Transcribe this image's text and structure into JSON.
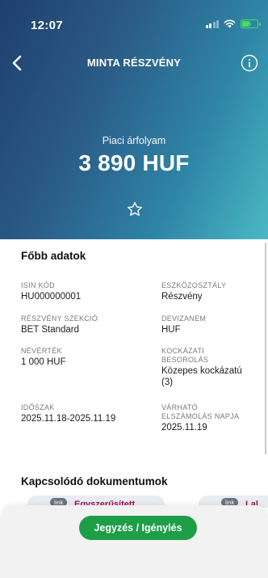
{
  "status_bar": {
    "time": "12:07",
    "icons": [
      "signal-icon",
      "wifi-icon",
      "battery-charging-icon"
    ]
  },
  "nav": {
    "title": "MINTA RÉSZVÉNY",
    "back_icon": "chevron-left-icon",
    "info_icon": "info-icon"
  },
  "price": {
    "label": "Piaci árfolyam",
    "value": "3 890 HUF"
  },
  "favorite": {
    "icon": "star-outline-icon"
  },
  "main_data": {
    "title": "Főbb adatok",
    "fields": [
      {
        "label": "ISIN KÓD",
        "value": "HU000000001"
      },
      {
        "label": "ESZKÖZOSZTÁLY",
        "value": "Részvény"
      },
      {
        "label": "RÉSZVÉNY SZEKCIÓ",
        "value": "BET Standard"
      },
      {
        "label": "DEVIZANEM",
        "value": "HUF"
      },
      {
        "label": "NÉVÉRTÉK",
        "value": "1 000 HUF"
      },
      {
        "label_line1": "KOCKÁZATI",
        "label_line2": "BESOROLÁS",
        "value_line1": "Közepes kockázatú",
        "value_line2": "(3)"
      },
      {
        "label": "IDŐSZAK",
        "value": "2025.11.18-2025.11.19"
      },
      {
        "label_line1": "VÁRHATÓ",
        "label_line2": "ELSZÁMOLÁS NAPJA",
        "value": "2025.11.19"
      }
    ]
  },
  "documents": {
    "title": "Kapcsolódó dokumentumok",
    "items": [
      {
        "badge": "link",
        "label": "Egyszerűsített"
      },
      {
        "badge": "link",
        "label": "Lal"
      }
    ]
  },
  "cta": {
    "label": "Jegyzés / Igénylés"
  },
  "colors": {
    "gradient_start": "#1f3f6e",
    "gradient_end": "#4ab9c4",
    "cta_green": "#1e9e47",
    "doc_link": "#a4115c",
    "battery": "#4cd964"
  }
}
